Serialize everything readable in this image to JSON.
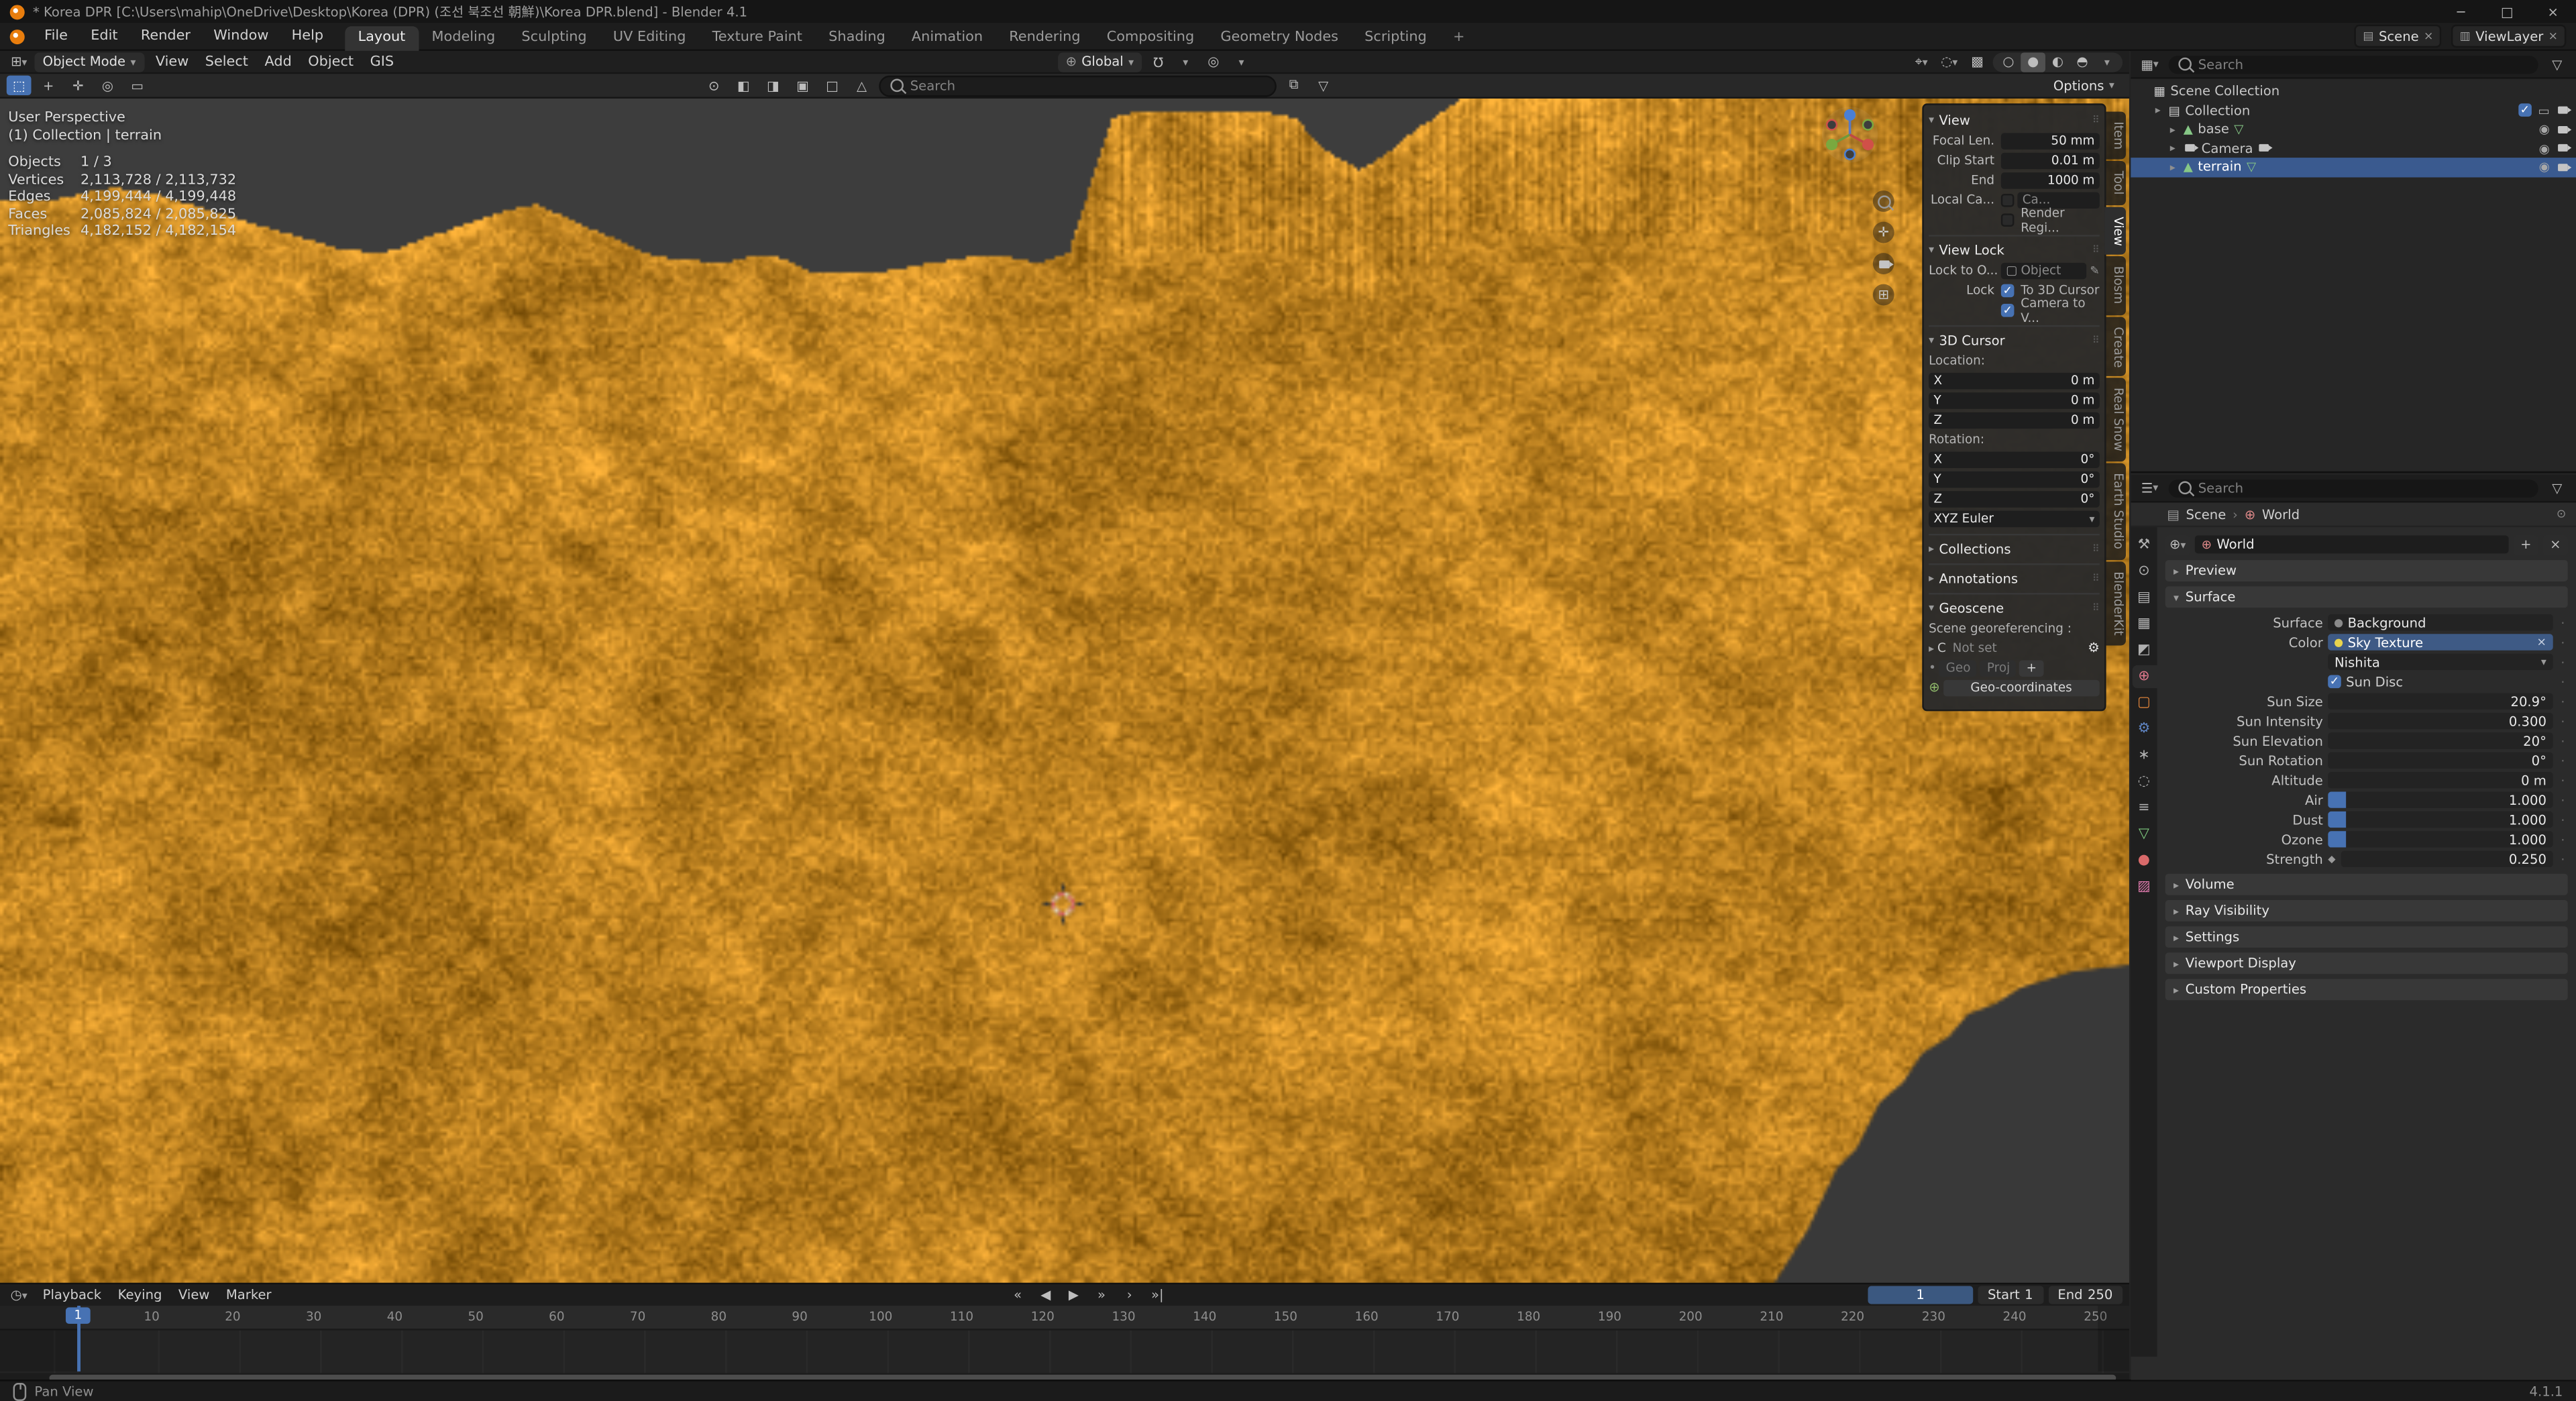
{
  "colors": {
    "accent": "#4772b3",
    "selection_orange": "#e87d0d"
  },
  "titlebar": {
    "title": "* Korea DPR [C:\\Users\\mahip\\OneDrive\\Desktop\\Korea (DPR) (조선 북조선 朝鮮)\\Korea DPR.blend] - Blender 4.1",
    "minimize": "─",
    "maximize": "□",
    "close": "×"
  },
  "topbar": {
    "menus": [
      "File",
      "Edit",
      "Render",
      "Window",
      "Help"
    ],
    "workspaces": [
      "Layout",
      "Modeling",
      "Sculpting",
      "UV Editing",
      "Texture Paint",
      "Shading",
      "Animation",
      "Rendering",
      "Compositing",
      "Geometry Nodes",
      "Scripting"
    ],
    "active_workspace": "Layout",
    "add_tab": "+",
    "scene_label": "Scene",
    "viewlayer_label": "ViewLayer"
  },
  "vp_header": {
    "mode": "Object Mode",
    "menus": [
      "View",
      "Select",
      "Add",
      "Object",
      "GIS"
    ],
    "orientation": "Global",
    "options_label": "Options"
  },
  "vp_toolbar": {
    "search_placeholder": "Search"
  },
  "viewport": {
    "overlay_line1": "User Perspective",
    "overlay_line2": "(1) Collection | terrain",
    "stats": [
      {
        "label": "Objects",
        "value": "1 / 3"
      },
      {
        "label": "Vertices",
        "value": "2,113,728 / 2,113,732"
      },
      {
        "label": "Edges",
        "value": "4,199,444 / 4,199,448"
      },
      {
        "label": "Faces",
        "value": "2,085,824 / 2,085,825"
      },
      {
        "label": "Triangles",
        "value": "4,182,152 / 4,182,154"
      }
    ],
    "colors": {
      "sky": "#3d3d3d",
      "terrain_dark": "#6f4704",
      "terrain_light": "#ffb43a",
      "sea": "#393939"
    },
    "terrain": {
      "ridge": [
        [
          0,
          58
        ],
        [
          70,
          50
        ],
        [
          130,
          70
        ],
        [
          205,
          92
        ],
        [
          265,
          82
        ],
        [
          325,
          62
        ],
        [
          395,
          88
        ],
        [
          465,
          100
        ],
        [
          535,
          104
        ],
        [
          600,
          96
        ],
        [
          650,
          90
        ],
        [
          665,
          46
        ],
        [
          676,
          12
        ],
        [
          692,
          6
        ],
        [
          788,
          8
        ],
        [
          806,
          26
        ],
        [
          826,
          36
        ],
        [
          850,
          24
        ],
        [
          878,
          8
        ],
        [
          905,
          -6
        ],
        [
          1296,
          -6
        ]
      ],
      "sea": [
        [
          1080,
          722
        ],
        [
          1100,
          690
        ],
        [
          1118,
          652
        ],
        [
          1130,
          640
        ],
        [
          1144,
          612
        ],
        [
          1158,
          600
        ],
        [
          1170,
          582
        ],
        [
          1186,
          572
        ],
        [
          1198,
          558
        ],
        [
          1214,
          552
        ],
        [
          1230,
          542
        ],
        [
          1262,
          532
        ],
        [
          1296,
          528
        ],
        [
          1296,
          722
        ]
      ],
      "cursor": [
        647,
        491
      ]
    }
  },
  "npanel": {
    "tabs": [
      "Item",
      "Tool",
      "View",
      "Blosm",
      "Create",
      "Real Snow",
      "Earth Studio",
      "BlenderKit"
    ],
    "active_tab": "View",
    "view_section": {
      "title": "View",
      "focal_label": "Focal Len.",
      "focal_value": "50 mm",
      "clip_start_label": "Clip Start",
      "clip_start_value": "0.01 m",
      "clip_end_label": "End",
      "clip_end_value": "1000 m",
      "local_cam_label": "Local Ca...",
      "local_cam_value": "Ca...",
      "render_region_label": "Render Regi..."
    },
    "view_lock_section": {
      "title": "View Lock",
      "lock_to_label": "Lock to O...",
      "lock_to_value": "Object",
      "lock_label": "Lock",
      "lock_cursor": "To 3D Cursor",
      "lock_camera": "Camera to V..."
    },
    "cursor_section": {
      "title": "3D Cursor",
      "location_label": "Location:",
      "rotation_label": "Rotation:",
      "loc": [
        {
          "axis": "X",
          "value": "0 m"
        },
        {
          "axis": "Y",
          "value": "0 m"
        },
        {
          "axis": "Z",
          "value": "0 m"
        }
      ],
      "rot": [
        {
          "axis": "X",
          "value": "0°"
        },
        {
          "axis": "Y",
          "value": "0°"
        },
        {
          "axis": "Z",
          "value": "0°"
        }
      ],
      "euler": "XYZ Euler"
    },
    "collections_title": "Collections",
    "annotations_title": "Annotations",
    "geoscene": {
      "title": "Geoscene",
      "georef_label": "Scene georeferencing :",
      "crs_prefix": "C",
      "crs_value": "Not set",
      "geo_btn": "Geo",
      "proj_btn": "Proj",
      "add_btn": "+",
      "coords_btn": "Geo-coordinates"
    }
  },
  "outliner": {
    "search_placeholder": "Search",
    "root_label": "Scene Collection",
    "rows": [
      {
        "label": "Scene Collection",
        "depth": 0,
        "icon": "scene-collection",
        "caret": false,
        "toggles": []
      },
      {
        "label": "Collection",
        "depth": 1,
        "icon": "collection",
        "caret": true,
        "toggles": [
          "checkbox",
          "screen",
          "camera"
        ]
      },
      {
        "label": "base",
        "depth": 2,
        "icon": "mesh",
        "caret": true,
        "data_icon": "mesh-data",
        "toggles": [
          "eye",
          "camera"
        ]
      },
      {
        "label": "Camera",
        "depth": 2,
        "icon": "camera",
        "caret": true,
        "data_icon": "camera-data",
        "toggles": [
          "eye",
          "camera"
        ]
      },
      {
        "label": "terrain",
        "depth": 2,
        "icon": "mesh",
        "caret": true,
        "data_icon": "mesh-data",
        "selected": true,
        "toggles": [
          "eye",
          "camera"
        ]
      }
    ]
  },
  "properties": {
    "search_placeholder": "Search",
    "breadcrumb_scene": "Scene",
    "breadcrumb_sep": "›",
    "breadcrumb_world": "World",
    "datablock_name": "World",
    "preview_title": "Preview",
    "surface": {
      "title": "Surface",
      "surface_label": "Surface",
      "surface_value": "Background",
      "color_label": "Color",
      "color_value": "Sky Texture",
      "sky_model": "Nishita",
      "sun_disc_label": "Sun Disc",
      "params": [
        {
          "label": "Sun Size",
          "value": "20.9°"
        },
        {
          "label": "Sun Intensity",
          "value": "0.300"
        },
        {
          "label": "Sun Elevation",
          "value": "20°"
        },
        {
          "label": "Sun Rotation",
          "value": "0°"
        },
        {
          "label": "Altitude",
          "value": "0 m"
        },
        {
          "label": "Air",
          "value": "1.000",
          "fill": true
        },
        {
          "label": "Dust",
          "value": "1.000",
          "fill": true
        },
        {
          "label": "Ozone",
          "value": "1.000",
          "fill": true
        },
        {
          "label": "Strength",
          "value": "0.250",
          "decorator": true
        }
      ]
    },
    "collapsed": [
      "Volume",
      "Ray Visibility",
      "Settings",
      "Viewport Display",
      "Custom Properties"
    ],
    "tabs": [
      {
        "name": "tool",
        "glyph": "⚒",
        "color": "#b0b0b0"
      },
      {
        "name": "render",
        "glyph": "⊙",
        "color": "#b0b0b0"
      },
      {
        "name": "output",
        "glyph": "▤",
        "color": "#b0b0b0"
      },
      {
        "name": "view-layer",
        "glyph": "▦",
        "color": "#b0b0b0"
      },
      {
        "name": "scene",
        "glyph": "◩",
        "color": "#b0b0b0"
      },
      {
        "name": "world",
        "glyph": "⊕",
        "color": "#e0788c",
        "active": true
      },
      {
        "name": "object",
        "glyph": "▢",
        "color": "#e8883a"
      },
      {
        "name": "modifiers",
        "glyph": "⚙",
        "color": "#5e83c0"
      },
      {
        "name": "particles",
        "glyph": "∗",
        "color": "#b0b0b0"
      },
      {
        "name": "physics",
        "glyph": "◌",
        "color": "#b0b0b0"
      },
      {
        "name": "constraints",
        "glyph": "≡",
        "color": "#b0b0b0"
      },
      {
        "name": "object-data",
        "glyph": "▽",
        "color": "#7ec97e"
      },
      {
        "name": "material",
        "glyph": "●",
        "color": "#d96a6a"
      },
      {
        "name": "texture",
        "glyph": "▨",
        "color": "#d977a8"
      }
    ]
  },
  "timeline": {
    "menus": [
      "Playback",
      "Keying",
      "View",
      "Marker"
    ],
    "controls": [
      "«",
      "◀",
      "▶",
      "»",
      "›",
      "»|"
    ],
    "frame": "1",
    "start_label": "Start",
    "start_value": "1",
    "end_label": "End",
    "end_value": "250",
    "tick_start": 10,
    "tick_step": 10,
    "tick_end": 250
  },
  "statusbar": {
    "hint": "Pan View",
    "version": "4.1.1"
  }
}
